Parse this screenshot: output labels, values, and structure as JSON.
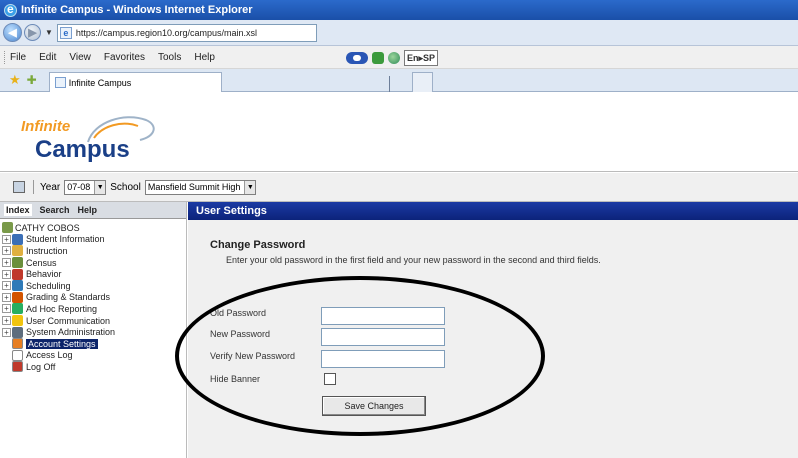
{
  "window": {
    "title": "Infinite Campus - Windows Internet Explorer"
  },
  "browser": {
    "address": "https://campus.region10.org/campus/main.xsl",
    "menu": [
      "File",
      "Edit",
      "View",
      "Favorites",
      "Tools",
      "Help"
    ],
    "language_selector": "En▸SP",
    "tab_title": "Infinite Campus"
  },
  "logo": {
    "line1": "Infinite",
    "line2": "Campus"
  },
  "context_bar": {
    "year_label": "Year",
    "year_value": "07-08",
    "school_label": "School",
    "school_value": "Mansfield Summit High"
  },
  "nav": {
    "tabs": [
      "Index",
      "Search",
      "Help"
    ],
    "user": "CATHY COBOS",
    "items": [
      {
        "label": "Student Information",
        "icon": "student-info-icon",
        "color": "#3b6fb6",
        "expandable": true
      },
      {
        "label": "Instruction",
        "icon": "instruction-icon",
        "color": "#e0b040",
        "expandable": true
      },
      {
        "label": "Census",
        "icon": "census-icon",
        "color": "#6a8f3c",
        "expandable": true
      },
      {
        "label": "Behavior",
        "icon": "behavior-icon",
        "color": "#c0392b",
        "expandable": true
      },
      {
        "label": "Scheduling",
        "icon": "scheduling-icon",
        "color": "#2f7ab8",
        "expandable": true
      },
      {
        "label": "Grading & Standards",
        "icon": "grading-icon",
        "color": "#d35400",
        "expandable": true
      },
      {
        "label": "Ad Hoc Reporting",
        "icon": "adhoc-icon",
        "color": "#27ae60",
        "expandable": true
      },
      {
        "label": "User Communication",
        "icon": "communication-icon",
        "color": "#f1c40f",
        "expandable": true
      },
      {
        "label": "System Administration",
        "icon": "sysadmin-icon",
        "color": "#5d6d7e",
        "expandable": true
      }
    ],
    "sub_items": [
      {
        "label": "Account Settings",
        "icon": "account-settings-icon",
        "color": "#e67e22",
        "selected": true
      },
      {
        "label": "Access Log",
        "icon": "access-log-icon",
        "color": "#ffffff",
        "selected": false
      },
      {
        "label": "Log Off",
        "icon": "log-off-icon",
        "color": "#c0392b",
        "selected": false
      }
    ]
  },
  "panel": {
    "header": "User Settings",
    "section_title": "Change Password",
    "section_desc": "Enter your old password in the first field and your new password in the second and third fields.",
    "fields": {
      "old_password": "Old Password",
      "new_password": "New Password",
      "verify_password": "Verify New Password",
      "hide_banner": "Hide Banner"
    },
    "save_button": "Save Changes"
  },
  "colors": {
    "title_bar": "#1a4fa8",
    "panel_header": "#0c237a",
    "logo_orange": "#f29a23",
    "logo_blue": "#1a3f87",
    "selected_item": "#0c246a"
  }
}
